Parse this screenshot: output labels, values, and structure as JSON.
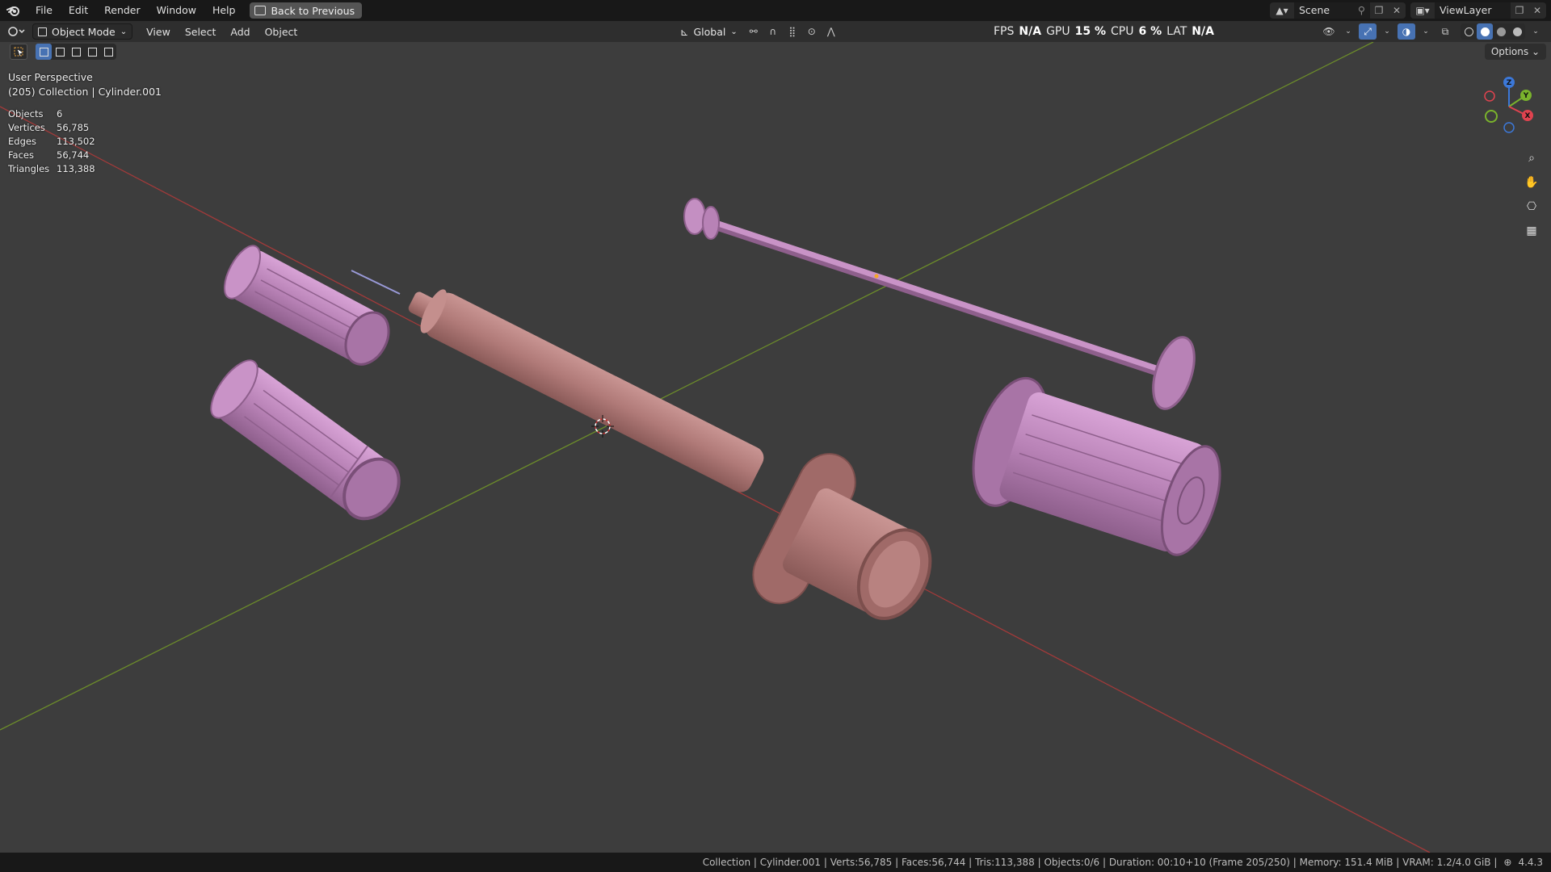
{
  "menubar": {
    "items": [
      "File",
      "Edit",
      "Render",
      "Window",
      "Help"
    ],
    "back_label": "Back to Previous",
    "scene": "Scene",
    "view_layer": "ViewLayer"
  },
  "header": {
    "mode": "Object Mode",
    "menus": [
      "View",
      "Select",
      "Add",
      "Object"
    ],
    "orientation": "Global",
    "perf": {
      "fps_label": "FPS",
      "fps": "N/A",
      "gpu_label": "GPU",
      "gpu": "15 %",
      "cpu_label": "CPU",
      "cpu": "6 %",
      "lat_label": "LAT",
      "lat": "N/A"
    }
  },
  "toolrow": {
    "options_label": "Options"
  },
  "viewport": {
    "view_name": "User Perspective",
    "context": "(205) Collection | Cylinder.001",
    "stats": [
      {
        "label": "Objects",
        "value": "6"
      },
      {
        "label": "Vertices",
        "value": "56,785"
      },
      {
        "label": "Edges",
        "value": "113,502"
      },
      {
        "label": "Faces",
        "value": "56,744"
      },
      {
        "label": "Triangles",
        "value": "113,388"
      }
    ],
    "gizmo": {
      "x": "X",
      "y": "Y",
      "z": "Z"
    }
  },
  "statusbar": {
    "text": "Collection | Cylinder.001 | Verts:56,785 | Faces:56,744 | Tris:113,388 | Objects:0/6 | Duration: 00:10+10 (Frame 205/250) | Memory: 151.4 MiB | VRAM: 1.2/4.0 GiB |",
    "version": "4.4.3"
  },
  "colors": {
    "viewport_bg": "#3d3d3d",
    "x_axis": "#a33a3a",
    "y_axis": "#6c8c2a",
    "syringe_body": "#b07a78",
    "parts_pink": "#b882b6",
    "accent": "#4772b3"
  }
}
